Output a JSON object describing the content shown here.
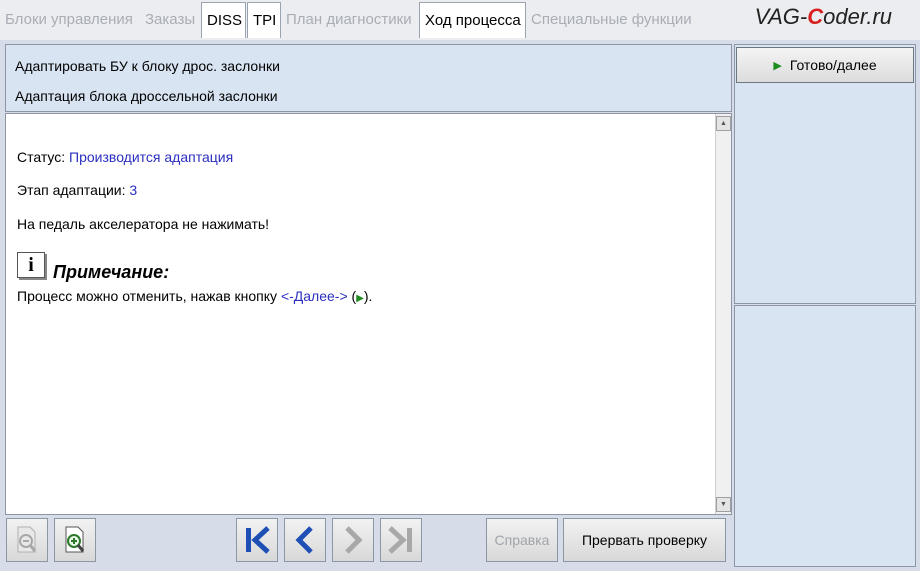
{
  "tabs": [
    {
      "label": "Блоки управления",
      "enabled": false
    },
    {
      "label": "Заказы",
      "enabled": false
    },
    {
      "label": "DISS",
      "enabled": true
    },
    {
      "label": "TPI",
      "enabled": true
    },
    {
      "label": "План диагностики",
      "enabled": false
    },
    {
      "label": "Ход процесса",
      "enabled": true
    },
    {
      "label": "Специальные функции",
      "enabled": false
    }
  ],
  "brand": {
    "part1": "VAG-",
    "part2": "C",
    "part3": "oder.ru"
  },
  "header": {
    "line1": "Адаптировать БУ к блоку дрос. заслонки",
    "line2": "Адаптация блока дроссельной заслонки"
  },
  "right_panel": {
    "done_button": "Готово/далее"
  },
  "content": {
    "status_label": "Статус:",
    "status_value": "Производится адаптация",
    "stage_label": "Этап адаптации:",
    "stage_value": "3",
    "warning": "На педаль акселератора не нажимать!",
    "note_icon": "i",
    "note_title": "Примечание:",
    "note_text_1": "Процесс можно отменить, нажав кнопку",
    "note_link": "<-Далее->",
    "note_open": "(",
    "note_close": ")."
  },
  "toolbar": {
    "help_label": "Справка",
    "abort_label": "Прервать проверку"
  },
  "colors": {
    "accent_blue": "#2b2fbf",
    "nav_blue": "#1e4fb5",
    "play_green": "#1f8c1f",
    "panel_bg": "#d8e4f2"
  }
}
